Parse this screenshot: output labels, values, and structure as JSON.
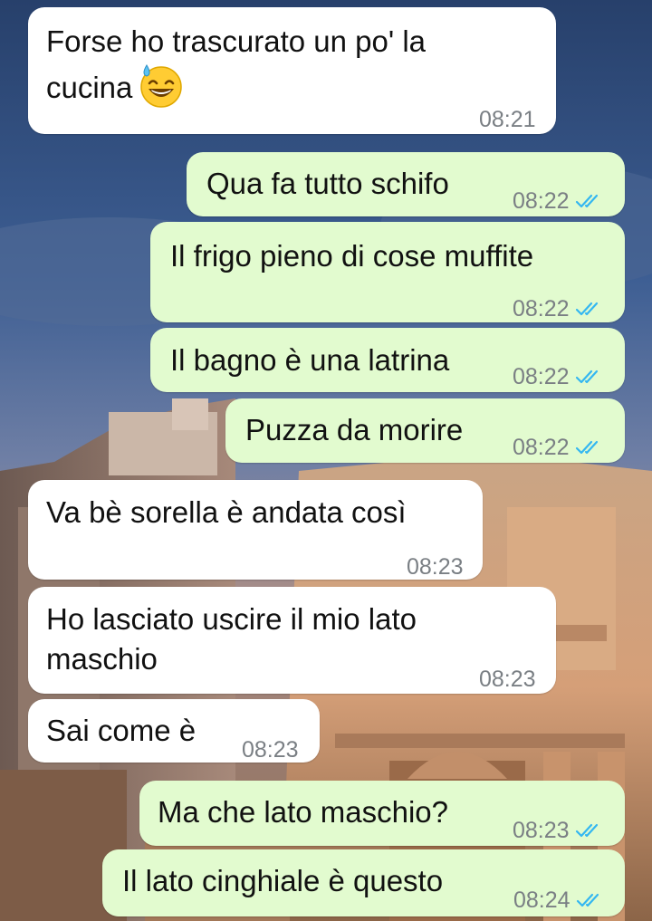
{
  "theme": {
    "incoming_bg": "#ffffff",
    "outgoing_bg": "#e2fbcf",
    "tick_color": "#34b7f1",
    "time_color": "#7a7f84"
  },
  "messages": [
    {
      "direction": "incoming",
      "lines": [
        "Forse ho trascurato un po' la",
        "cucina"
      ],
      "emoji": "grinning-face-with-sweat-icon",
      "time": "08:21"
    },
    {
      "direction": "outgoing",
      "lines": [
        "Qua fa tutto schifo"
      ],
      "time": "08:22",
      "status": "read"
    },
    {
      "direction": "outgoing",
      "lines": [
        "Il frigo pieno di cose muffite"
      ],
      "time": "08:22",
      "status": "read"
    },
    {
      "direction": "outgoing",
      "lines": [
        "Il bagno è una latrina"
      ],
      "time": "08:22",
      "status": "read"
    },
    {
      "direction": "outgoing",
      "lines": [
        "Puzza da morire"
      ],
      "time": "08:22",
      "status": "read"
    },
    {
      "direction": "incoming",
      "lines": [
        "Va bè sorella è andata così"
      ],
      "time": "08:23"
    },
    {
      "direction": "incoming",
      "lines": [
        "Ho lasciato uscire il mio lato",
        "maschio"
      ],
      "time": "08:23"
    },
    {
      "direction": "incoming",
      "lines": [
        "Sai come è"
      ],
      "time": "08:23"
    },
    {
      "direction": "outgoing",
      "lines": [
        "Ma che lato maschio?"
      ],
      "time": "08:23",
      "status": "read"
    },
    {
      "direction": "outgoing",
      "lines": [
        "Il lato cinghiale è questo"
      ],
      "time": "08:24",
      "status": "read"
    }
  ]
}
